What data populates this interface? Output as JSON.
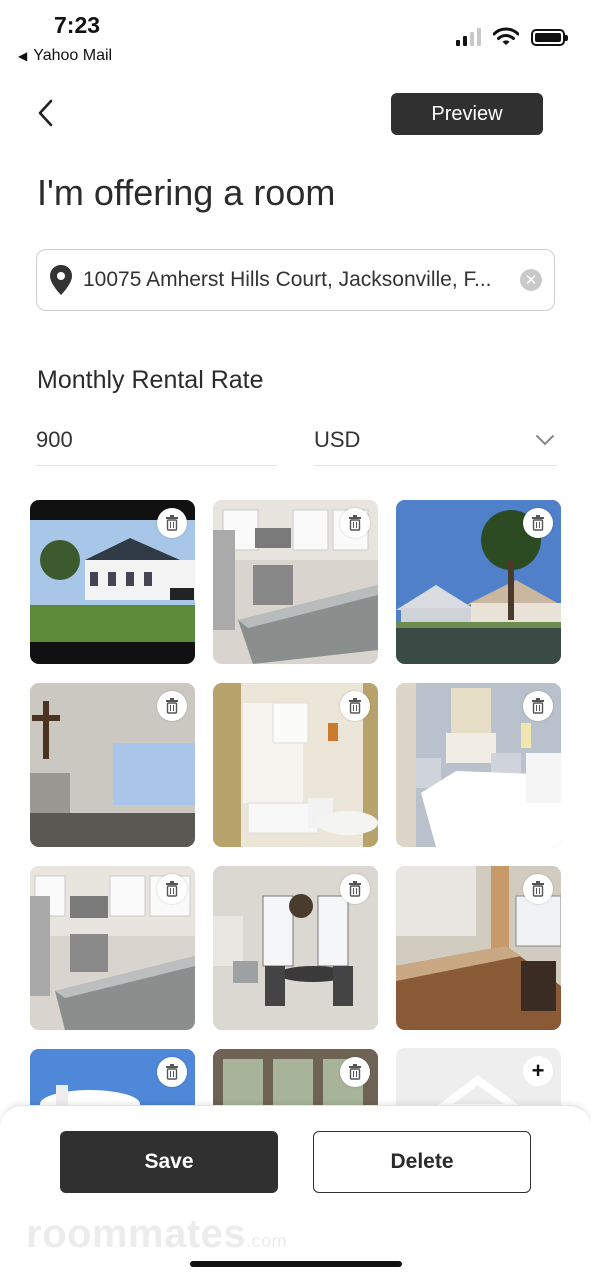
{
  "status_bar": {
    "time": "7:23",
    "back_app": "Yahoo Mail",
    "back_icon": "back-triangle-icon"
  },
  "header": {
    "back_icon": "chevron-left-icon",
    "preview_label": "Preview"
  },
  "title": "I'm offering a room",
  "address": {
    "value": "10075 Amherst Hills Court, Jacksonville, F...",
    "pin_icon": "location-pin-icon",
    "clear_icon": "clear-icon"
  },
  "rental": {
    "label": "Monthly Rental Rate",
    "amount": "900",
    "currency": "USD"
  },
  "photos": [
    {
      "subject": "clubhouse exterior"
    },
    {
      "subject": "kitchen"
    },
    {
      "subject": "house by lake"
    },
    {
      "subject": "room with cross and projector"
    },
    {
      "subject": "bathroom"
    },
    {
      "subject": "bedroom"
    },
    {
      "subject": "kitchen"
    },
    {
      "subject": "dining room"
    },
    {
      "subject": "kitchen island"
    },
    {
      "subject": "exterior sky"
    },
    {
      "subject": "window interior"
    }
  ],
  "actions": {
    "save_label": "Save",
    "delete_label": "Delete"
  },
  "brand": {
    "name": "roommates",
    "suffix": ".com"
  },
  "colors": {
    "primary_button": "#303030",
    "text": "#2b2b2b"
  }
}
